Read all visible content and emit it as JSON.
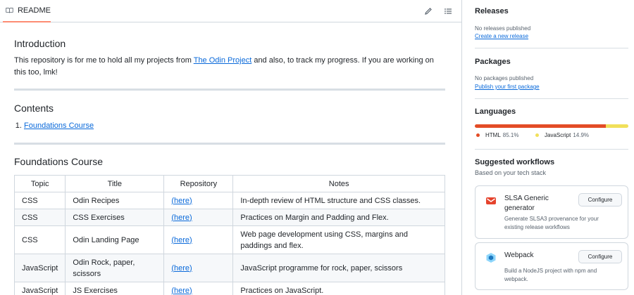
{
  "readme": {
    "tab_label": "README",
    "intro_heading": "Introduction",
    "intro_text_before": "This repository is for me to hold all my projects from ",
    "intro_link": "The Odin Project",
    "intro_text_after": " and also, to track my progress. If you are working on this too, lmk!",
    "contents_heading": "Contents",
    "contents_items": [
      "Foundations Course"
    ],
    "fc_heading": "Foundations Course",
    "table": {
      "headers": [
        "Topic",
        "Title",
        "Repository",
        "Notes"
      ],
      "rows": [
        {
          "topic": "CSS",
          "title": "Odin Recipes",
          "repo": "(here)",
          "notes": "In-depth review of HTML structure and CSS classes."
        },
        {
          "topic": "CSS",
          "title": "CSS Exercises",
          "repo": "(here)",
          "notes": "Practices on Margin and Padding and Flex."
        },
        {
          "topic": "CSS",
          "title": "Odin Landing Page",
          "repo": "(here)",
          "notes": "Web page development using CSS, margins and paddings and flex."
        },
        {
          "topic": "JavaScript",
          "title": "Odin Rock, paper, scissors",
          "repo": "(here)",
          "notes": "JavaScript programme for rock, paper, scissors"
        },
        {
          "topic": "JavaScript",
          "title": "JS Exercises",
          "repo": "(here)",
          "notes": "Practices on JavaScript."
        }
      ]
    }
  },
  "sidebar": {
    "releases": {
      "heading": "Releases",
      "empty": "No releases published",
      "link": "Create a new release"
    },
    "packages": {
      "heading": "Packages",
      "empty": "No packages published",
      "link": "Publish your first package"
    },
    "languages": {
      "heading": "Languages",
      "items": [
        {
          "name": "HTML",
          "percent": "85.1%",
          "value": 85.1,
          "color": "#e34c26"
        },
        {
          "name": "JavaScript",
          "percent": "14.9%",
          "value": 14.9,
          "color": "#f1e05a"
        }
      ]
    },
    "workflows": {
      "heading": "Suggested workflows",
      "subheading": "Based on your tech stack",
      "items": [
        {
          "title": "SLSA Generic generator",
          "description": "Generate SLSA3 provenance for your existing release workflows",
          "button": "Configure",
          "icon": "slsa-icon"
        },
        {
          "title": "Webpack",
          "description": "Build a NodeJS project with npm and webpack.",
          "button": "Configure",
          "icon": "webpack-icon"
        }
      ]
    }
  },
  "colors": {
    "accent_link": "#0969da",
    "tab_underline": "#fd8c73",
    "border": "#d0d7de"
  }
}
